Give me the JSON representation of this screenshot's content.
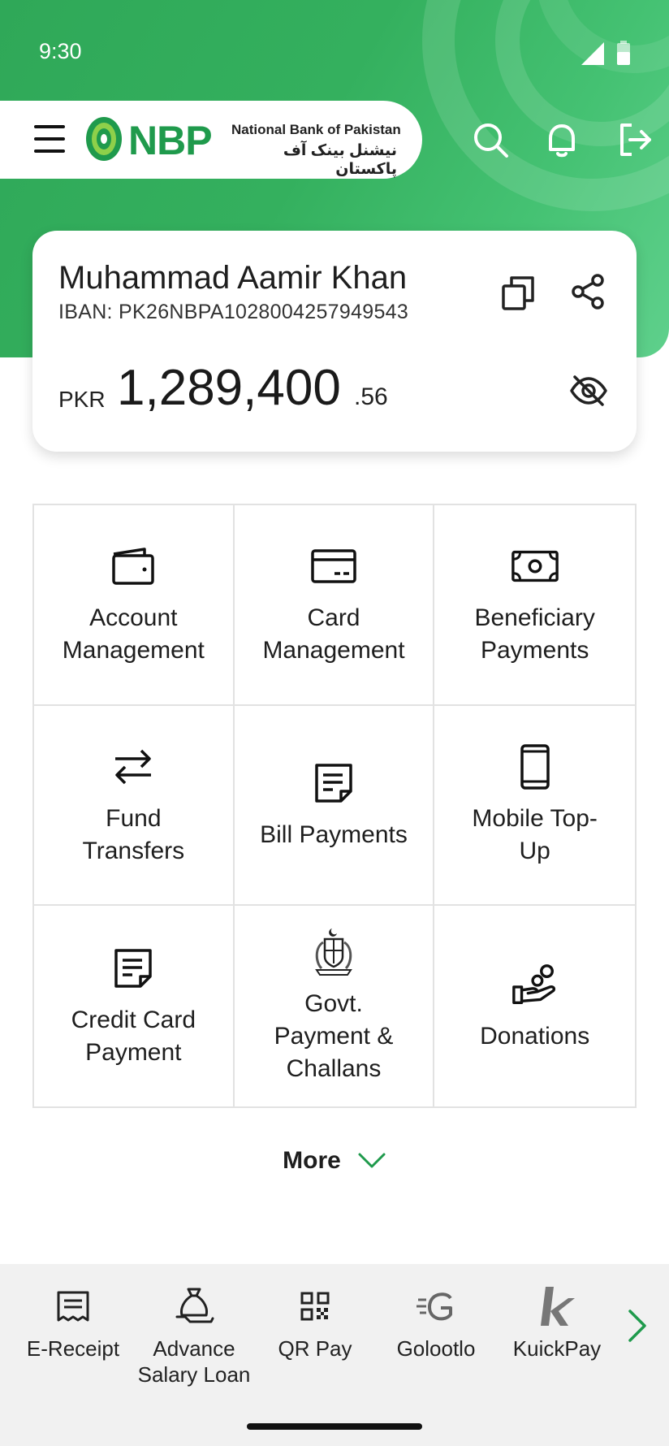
{
  "status_bar": {
    "time": "9:30"
  },
  "header": {
    "logo_text": "NBP",
    "bank_name_en": "National Bank of Pakistan",
    "bank_name_ur": "نیشنل بینک آف پاکستان",
    "icons": [
      "menu-icon",
      "search-icon",
      "bell-icon",
      "logout-icon"
    ]
  },
  "account": {
    "name": "Muhammad Aamir Khan",
    "iban": "IBAN: PK26NBPA1028004257949543",
    "currency": "PKR",
    "balance": "1,289,400",
    "decimals": ".56",
    "icons": [
      "copy-icon",
      "share-icon",
      "eye-off-icon"
    ]
  },
  "services": [
    {
      "label": "Account\nManagement",
      "icon": "wallet-icon"
    },
    {
      "label": "Card\nManagement",
      "icon": "card-icon"
    },
    {
      "label": "Beneficiary\nPayments",
      "icon": "banknote-icon"
    },
    {
      "label": "Fund\nTransfers",
      "icon": "transfer-arrows-icon"
    },
    {
      "label": "Bill Payments",
      "icon": "bill-icon"
    },
    {
      "label": "Mobile Top-\nUp",
      "icon": "mobile-icon"
    },
    {
      "label": "Credit Card\nPayment",
      "icon": "credit-card-bill-icon"
    },
    {
      "label": "Govt.\nPayment &\nChallans",
      "icon": "govt-emblem-icon"
    },
    {
      "label": "Donations",
      "icon": "donation-hand-icon"
    }
  ],
  "more": {
    "label": "More",
    "icon": "chevron-down-icon"
  },
  "quick_bar": [
    {
      "label": "E-Receipt",
      "icon": "receipt-icon"
    },
    {
      "label": "Advance\nSalary Loan",
      "icon": "money-bag-icon"
    },
    {
      "label": "QR Pay",
      "icon": "qr-code-icon"
    },
    {
      "label": "Golootlo",
      "icon": "golootlo-logo"
    },
    {
      "label": "KuickPay",
      "icon": "kuickpay-logo"
    }
  ],
  "colors": {
    "brand_green": "#34b05e",
    "logo_green": "#1f9a4c",
    "accent_green": "#1f9a4c"
  }
}
